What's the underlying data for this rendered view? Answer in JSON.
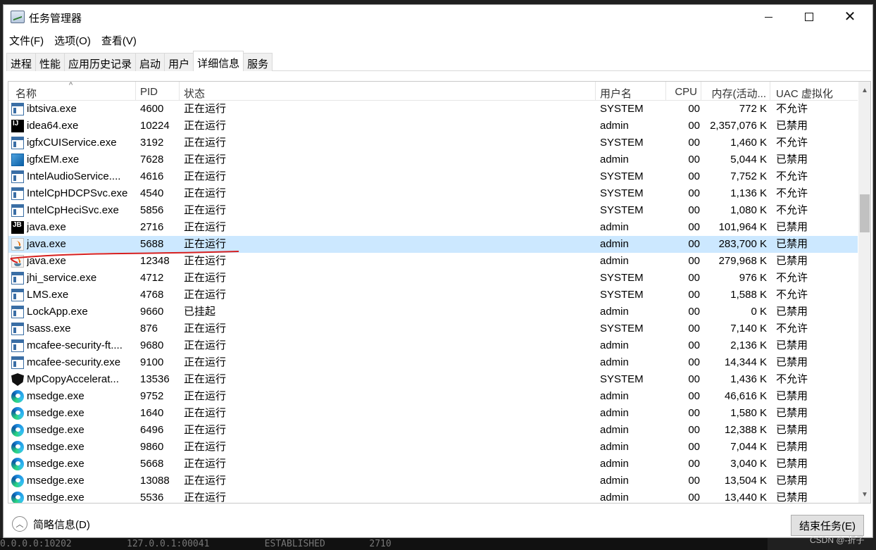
{
  "window": {
    "title": "任务管理器"
  },
  "menu": [
    "文件(F)",
    "选项(O)",
    "查看(V)"
  ],
  "tabs": [
    {
      "label": "进程",
      "active": false
    },
    {
      "label": "性能",
      "active": false
    },
    {
      "label": "应用历史记录",
      "active": false
    },
    {
      "label": "启动",
      "active": false
    },
    {
      "label": "用户",
      "active": false
    },
    {
      "label": "详细信息",
      "active": true
    },
    {
      "label": "服务",
      "active": false
    }
  ],
  "columns": {
    "name": "名称",
    "pid": "PID",
    "status": "状态",
    "user": "用户名",
    "cpu": "CPU",
    "memory": "内存(活动...",
    "uac": "UAC 虚拟化"
  },
  "rows": [
    {
      "icon": "window-icon",
      "name": "ibtsiva.exe",
      "pid": "4600",
      "status": "正在运行",
      "user": "SYSTEM",
      "cpu": "00",
      "memory": "772 K",
      "uac": "不允许"
    },
    {
      "icon": "intellij-icon",
      "name": "idea64.exe",
      "pid": "10224",
      "status": "正在运行",
      "user": "admin",
      "cpu": "00",
      "memory": "2,357,076 K",
      "uac": "已禁用"
    },
    {
      "icon": "window-icon",
      "name": "igfxCUIService.exe",
      "pid": "3192",
      "status": "正在运行",
      "user": "SYSTEM",
      "cpu": "00",
      "memory": "1,460 K",
      "uac": "不允许"
    },
    {
      "icon": "intel-graphics-icon",
      "name": "igfxEM.exe",
      "pid": "7628",
      "status": "正在运行",
      "user": "admin",
      "cpu": "00",
      "memory": "5,044 K",
      "uac": "已禁用"
    },
    {
      "icon": "window-icon",
      "name": "IntelAudioService....",
      "pid": "4616",
      "status": "正在运行",
      "user": "SYSTEM",
      "cpu": "00",
      "memory": "7,752 K",
      "uac": "不允许"
    },
    {
      "icon": "window-icon",
      "name": "IntelCpHDCPSvc.exe",
      "pid": "4540",
      "status": "正在运行",
      "user": "SYSTEM",
      "cpu": "00",
      "memory": "1,136 K",
      "uac": "不允许"
    },
    {
      "icon": "window-icon",
      "name": "IntelCpHeciSvc.exe",
      "pid": "5856",
      "status": "正在运行",
      "user": "SYSTEM",
      "cpu": "00",
      "memory": "1,080 K",
      "uac": "不允许"
    },
    {
      "icon": "jetbrains-icon",
      "name": "java.exe",
      "pid": "2716",
      "status": "正在运行",
      "user": "admin",
      "cpu": "00",
      "memory": "101,964 K",
      "uac": "已禁用"
    },
    {
      "icon": "java-icon",
      "name": "java.exe",
      "pid": "5688",
      "status": "正在运行",
      "user": "admin",
      "cpu": "00",
      "memory": "283,700 K",
      "uac": "已禁用",
      "selected": true
    },
    {
      "icon": "java-icon",
      "name": "java.exe",
      "pid": "12348",
      "status": "正在运行",
      "user": "admin",
      "cpu": "00",
      "memory": "279,968 K",
      "uac": "已禁用"
    },
    {
      "icon": "window-icon",
      "name": "jhi_service.exe",
      "pid": "4712",
      "status": "正在运行",
      "user": "SYSTEM",
      "cpu": "00",
      "memory": "976 K",
      "uac": "不允许"
    },
    {
      "icon": "window-icon",
      "name": "LMS.exe",
      "pid": "4768",
      "status": "正在运行",
      "user": "SYSTEM",
      "cpu": "00",
      "memory": "1,588 K",
      "uac": "不允许"
    },
    {
      "icon": "window-icon",
      "name": "LockApp.exe",
      "pid": "9660",
      "status": "已挂起",
      "user": "admin",
      "cpu": "00",
      "memory": "0 K",
      "uac": "已禁用"
    },
    {
      "icon": "window-icon",
      "name": "lsass.exe",
      "pid": "876",
      "status": "正在运行",
      "user": "SYSTEM",
      "cpu": "00",
      "memory": "7,140 K",
      "uac": "不允许"
    },
    {
      "icon": "window-icon",
      "name": "mcafee-security-ft....",
      "pid": "9680",
      "status": "正在运行",
      "user": "admin",
      "cpu": "00",
      "memory": "2,136 K",
      "uac": "已禁用"
    },
    {
      "icon": "window-icon",
      "name": "mcafee-security.exe",
      "pid": "9100",
      "status": "正在运行",
      "user": "admin",
      "cpu": "00",
      "memory": "14,344 K",
      "uac": "已禁用"
    },
    {
      "icon": "shield-icon",
      "name": "MpCopyAccelerat...",
      "pid": "13536",
      "status": "正在运行",
      "user": "SYSTEM",
      "cpu": "00",
      "memory": "1,436 K",
      "uac": "不允许"
    },
    {
      "icon": "edge-icon",
      "name": "msedge.exe",
      "pid": "9752",
      "status": "正在运行",
      "user": "admin",
      "cpu": "00",
      "memory": "46,616 K",
      "uac": "已禁用"
    },
    {
      "icon": "edge-icon",
      "name": "msedge.exe",
      "pid": "1640",
      "status": "正在运行",
      "user": "admin",
      "cpu": "00",
      "memory": "1,580 K",
      "uac": "已禁用"
    },
    {
      "icon": "edge-icon",
      "name": "msedge.exe",
      "pid": "6496",
      "status": "正在运行",
      "user": "admin",
      "cpu": "00",
      "memory": "12,388 K",
      "uac": "已禁用"
    },
    {
      "icon": "edge-icon",
      "name": "msedge.exe",
      "pid": "9860",
      "status": "正在运行",
      "user": "admin",
      "cpu": "00",
      "memory": "7,044 K",
      "uac": "已禁用"
    },
    {
      "icon": "edge-icon",
      "name": "msedge.exe",
      "pid": "5668",
      "status": "正在运行",
      "user": "admin",
      "cpu": "00",
      "memory": "3,040 K",
      "uac": "已禁用"
    },
    {
      "icon": "edge-icon",
      "name": "msedge.exe",
      "pid": "13088",
      "status": "正在运行",
      "user": "admin",
      "cpu": "00",
      "memory": "13,504 K",
      "uac": "已禁用"
    },
    {
      "icon": "edge-icon",
      "name": "msedge.exe",
      "pid": "5536",
      "status": "正在运行",
      "user": "admin",
      "cpu": "00",
      "memory": "13,440 K",
      "uac": "已禁用"
    }
  ],
  "footer": {
    "fewer_details": "简略信息(D)",
    "end_task": "结束任务(E)"
  },
  "background_text": "0.0.0.0:10202          127.0.0.1:00041          ESTABLISHED        2710",
  "watermark": "CSDN @-折子",
  "colors": {
    "selected_row": "#cce8ff",
    "annotation": "#d62020"
  }
}
